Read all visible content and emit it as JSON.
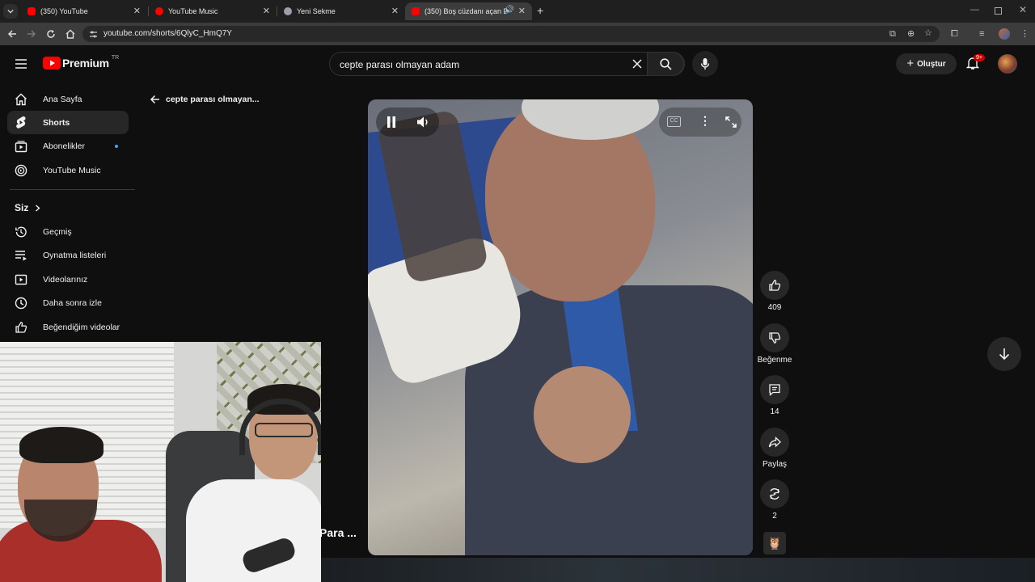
{
  "browser": {
    "tabs": [
      {
        "title": "(350) YouTube"
      },
      {
        "title": "YouTube Music"
      },
      {
        "title": "Yeni Sekme"
      },
      {
        "title": "(350) Boş cüzdanı açan Day"
      }
    ],
    "url": "youtube.com/shorts/6QlyC_HmQ7Y"
  },
  "header": {
    "logo_text": "Premium",
    "logo_region": "TR",
    "search_value": "cepte parası olmayan adam",
    "create_label": "Oluştur",
    "notif_count": "9+"
  },
  "sidebar": {
    "items": [
      {
        "label": "Ana Sayfa"
      },
      {
        "label": "Shorts"
      },
      {
        "label": "Abonelikler"
      },
      {
        "label": "YouTube Music"
      }
    ],
    "you_heading": "Siz",
    "you_items": [
      {
        "label": "Geçmiş"
      },
      {
        "label": "Oynatma listeleri"
      },
      {
        "label": "Videolarınız"
      },
      {
        "label": "Daha sonra izle"
      },
      {
        "label": "Beğendiğim videolar"
      }
    ]
  },
  "shorts": {
    "back_label": "cepte parası olmayan...",
    "overlay_title": "Para ...",
    "like_count": "409",
    "dislike_label": "Beğenme",
    "comment_count": "14",
    "share_label": "Paylaş",
    "remix_count": "2"
  },
  "colors": {
    "brand_red": "#ff0000",
    "bg": "#0f0f0f"
  }
}
